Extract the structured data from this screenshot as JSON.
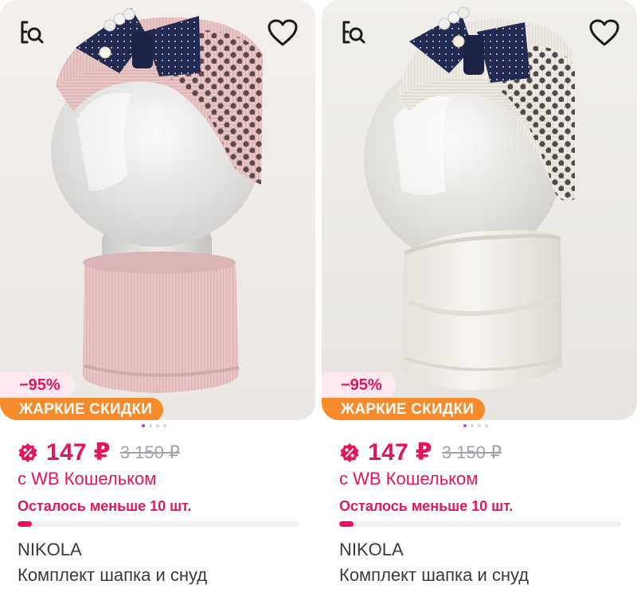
{
  "products": [
    {
      "variant": "pink",
      "discount": "−95%",
      "promo_badge": "ЖАРКИЕ СКИДКИ",
      "price": "147 ₽",
      "old_price": "3 150 ₽",
      "wallet_note": "с WB Кошельком",
      "stock_note": "Осталось меньше 10 шт.",
      "stock_level": 0.05,
      "brand": "NIKOLA",
      "title": "Комплект шапка и снуд",
      "image_dots": 4,
      "active_dot": 0,
      "icons": {
        "quick_view": "quick-view-icon",
        "favorite": "heart-icon",
        "price_badge": "percent-badge-icon"
      }
    },
    {
      "variant": "cream",
      "discount": "−95%",
      "promo_badge": "ЖАРКИЕ СКИДКИ",
      "price": "147 ₽",
      "old_price": "3 150 ₽",
      "wallet_note": "с WB Кошельком",
      "stock_note": "Осталось меньше 10 шт.",
      "stock_level": 0.05,
      "brand": "NIKOLA",
      "title": "Комплект шапка и снуд",
      "image_dots": 4,
      "active_dot": 0,
      "icons": {
        "quick_view": "quick-view-icon",
        "favorite": "heart-icon",
        "price_badge": "percent-badge-icon"
      }
    }
  ],
  "colors": {
    "accent": "#e4165a",
    "promo_orange": "#f78a2a",
    "discount_bg": "#fde8f0",
    "active_dot": "#a349d6",
    "pink_knit": "#e7c3c3",
    "cream_knit": "#f1eeea",
    "bow_navy": "#2a2f55"
  }
}
